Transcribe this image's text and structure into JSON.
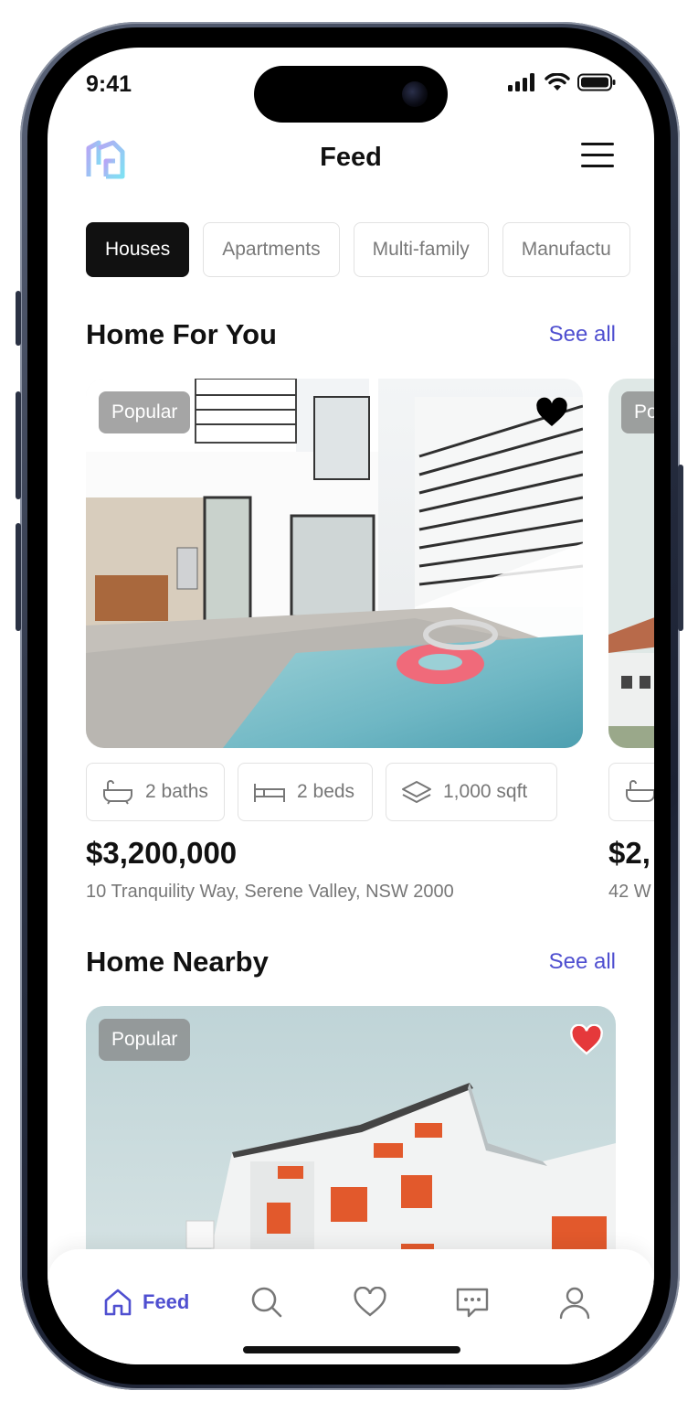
{
  "status": {
    "time": "9:41"
  },
  "header": {
    "title": "Feed"
  },
  "categories": [
    "Houses",
    "Apartments",
    "Multi-family",
    "Manufactu"
  ],
  "home_for_you": {
    "title": "Home For You",
    "see_all": "See all",
    "cards": [
      {
        "badge": "Popular",
        "baths": "2 baths",
        "beds": "2 beds",
        "area": "1,000 sqft",
        "price": "$3,200,000",
        "address": "10 Tranquility Way, Serene Valley, NSW 2000",
        "favorite_color": "#000000"
      },
      {
        "badge": "Po",
        "price": "$2,",
        "address": "42 W"
      }
    ]
  },
  "home_nearby": {
    "title": "Home Nearby",
    "see_all": "See all",
    "card": {
      "badge": "Popular",
      "favorite_color": "#e5393b"
    }
  },
  "tabbar": {
    "active_label": "Feed",
    "items": [
      "home-icon",
      "search-icon",
      "heart-icon",
      "chat-icon",
      "profile-icon"
    ]
  },
  "colors": {
    "accent": "#4f4fd0",
    "active_chip": "#111111"
  }
}
